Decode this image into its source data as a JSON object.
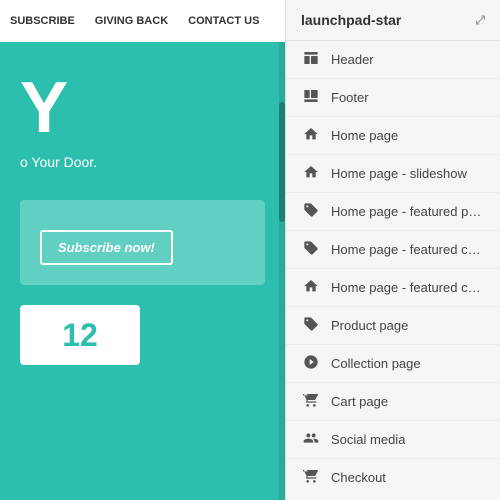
{
  "leftPanel": {
    "navItems": [
      "SUBSCRIBE",
      "GIVING BACK",
      "CONTACT US"
    ],
    "bigLetter": "Y",
    "tagline": "o Your Door.",
    "subscribeLabel": "Subscribe now!",
    "numberDisplay": "12"
  },
  "rightPanel": {
    "title": "launchpad-star",
    "expandIcon": "⤢",
    "menuItems": [
      {
        "id": "header",
        "label": "Header",
        "icon": "header"
      },
      {
        "id": "footer",
        "label": "Footer",
        "icon": "footer"
      },
      {
        "id": "home",
        "label": "Home page",
        "icon": "home"
      },
      {
        "id": "home-slideshow",
        "label": "Home page - slideshow",
        "icon": "home"
      },
      {
        "id": "home-featured-product",
        "label": "Home page - featured produc...",
        "icon": "tag"
      },
      {
        "id": "home-featured-collection",
        "label": "Home page - featured collecti...",
        "icon": "tag"
      },
      {
        "id": "home-featured-content",
        "label": "Home page - featured content...",
        "icon": "home"
      },
      {
        "id": "product-page",
        "label": "Product page",
        "icon": "tag"
      },
      {
        "id": "collection-page",
        "label": "Collection page",
        "icon": "tag2"
      },
      {
        "id": "cart-page",
        "label": "Cart page",
        "icon": "cart"
      },
      {
        "id": "social-media",
        "label": "Social media",
        "icon": "social"
      },
      {
        "id": "checkout",
        "label": "Checkout",
        "icon": "cart"
      }
    ]
  }
}
